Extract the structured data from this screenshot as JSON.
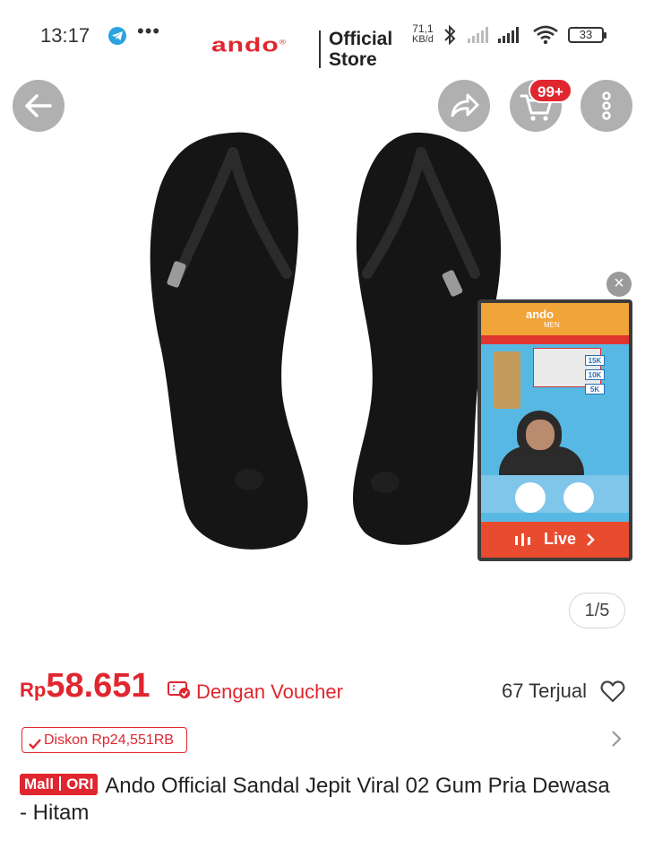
{
  "status_bar": {
    "time": "13:17",
    "more": "•••",
    "net_speed_value": "71,1",
    "net_speed_unit": "KB/d",
    "battery": "33"
  },
  "brand": {
    "logo": "ando",
    "registered": "®",
    "line1": "Official",
    "line2": "Store"
  },
  "nav": {
    "cart_badge": "99+"
  },
  "live_popup": {
    "close": "×",
    "logo": "ando",
    "logo_sub": "MEN",
    "price_tags": [
      "15K",
      "10K",
      "5K"
    ],
    "cta_label": "Live"
  },
  "gallery": {
    "counter": "1/5"
  },
  "product": {
    "currency": "Rp",
    "price": "58.651",
    "voucher_label": "Dengan Voucher",
    "sold": "67 Terjual",
    "discount": "Diskon Rp24,551RB",
    "badge_mall": "Mall",
    "badge_ori": "ORI",
    "title": "Ando Official Sandal Jepit Viral 02 Gum Pria Dewasa - Hitam"
  },
  "colors": {
    "accent": "#e0262f",
    "live_orange": "#e94b2e",
    "live_blue": "#57b9e3"
  }
}
